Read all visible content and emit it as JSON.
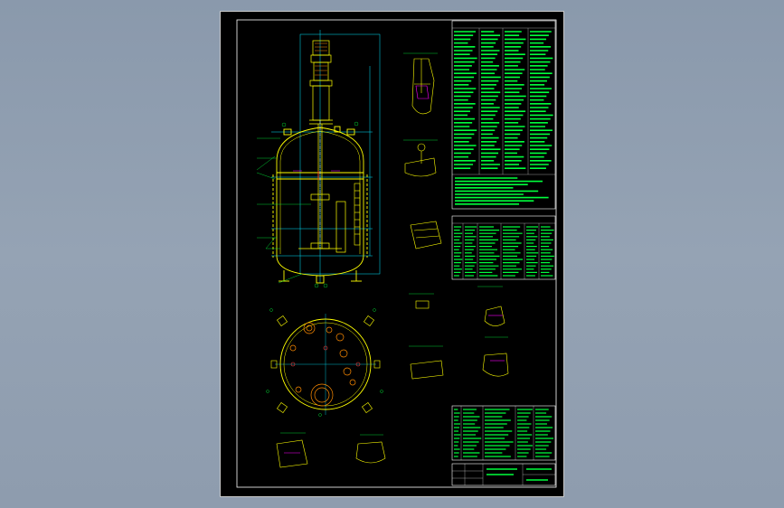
{
  "sheet": {
    "background": "#000000",
    "border_color": "#ffffff",
    "vessel_color": "#ffff00",
    "dimension_color": "#00e5ff",
    "annotation_color": "#00ff3c",
    "hatch_color": "#ff00ff",
    "nozzle_color": "#ff4040"
  },
  "icons": {
    "vessel": "reactor-vessel-elevation",
    "plan": "nozzle-orientation-plan",
    "details": "weld-detail-sections"
  }
}
